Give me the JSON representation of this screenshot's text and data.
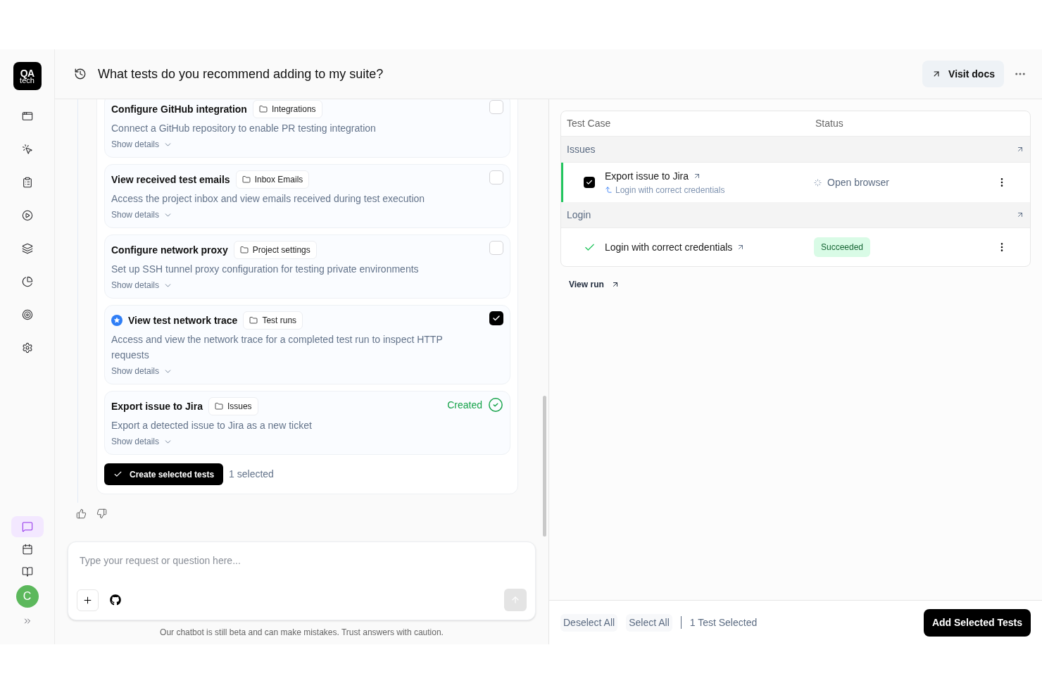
{
  "sidebar": {
    "logo": {
      "line1": "QA",
      "line2": "tech"
    },
    "nav_items": [
      {
        "kind": "window",
        "selected": false
      },
      {
        "kind": "click",
        "selected": false
      },
      {
        "kind": "clipboard",
        "selected": false
      },
      {
        "kind": "play",
        "selected": false
      },
      {
        "kind": "layers",
        "selected": false
      },
      {
        "kind": "pie",
        "selected": false
      },
      {
        "kind": "target",
        "selected": false
      },
      {
        "kind": "settings",
        "selected": false
      }
    ],
    "bottom_items": [
      {
        "kind": "chat",
        "selected": true
      },
      {
        "kind": "calendar",
        "selected": false
      },
      {
        "kind": "book",
        "selected": false
      }
    ],
    "avatar": "C"
  },
  "header": {
    "title": "What tests do you recommend adding to my suite?",
    "docs_button": "Visit docs"
  },
  "suggestions": [
    {
      "title": "Configure GitHub integration",
      "folder": "Integrations",
      "description": "Connect a GitHub repository to enable PR testing integration",
      "details": "Show details",
      "starred": false,
      "kind": "checkbox",
      "checked": false
    },
    {
      "title": "View received test emails",
      "folder": "Inbox Emails",
      "description": "Access the project inbox and view emails received during test execution",
      "details": "Show details",
      "starred": false,
      "kind": "checkbox",
      "checked": false
    },
    {
      "title": "Configure network proxy",
      "folder": "Project settings",
      "description": "Set up SSH tunnel proxy configuration for testing private environments",
      "details": "Show details",
      "starred": false,
      "kind": "checkbox",
      "checked": false
    },
    {
      "title": "View test network trace",
      "folder": "Test runs",
      "description": "Access and view the network trace for a completed test run to inspect HTTP requests",
      "details": "Show details",
      "starred": true,
      "kind": "checkbox",
      "checked": true
    },
    {
      "title": "Export issue to Jira",
      "folder": "Issues",
      "description": "Export a detected issue to Jira as a new ticket",
      "details": "Show details",
      "starred": false,
      "kind": "created",
      "status": "Created"
    }
  ],
  "create_button": "Create selected tests",
  "selected_count": "1 selected",
  "input": {
    "placeholder": "Type your request or question here..."
  },
  "disclaimer": "Our chatbot is still beta and can make mistakes. Trust answers with caution.",
  "table": {
    "columns": [
      "Test Case",
      "Status"
    ],
    "groups": [
      {
        "name": "Issues",
        "rows": [
          {
            "kind": "selectable",
            "checked": true,
            "active": true,
            "name": "Export issue to Jira",
            "parent": "Login with correct credentials",
            "status": {
              "kind": "running",
              "text": "Open browser"
            }
          }
        ]
      },
      {
        "name": "Login",
        "rows": [
          {
            "kind": "passed",
            "active": false,
            "name": "Login with correct credentials",
            "status": {
              "kind": "succeeded",
              "text": "Succeeded"
            }
          }
        ]
      }
    ]
  },
  "view_run": "View run",
  "footer": {
    "deselect": "Deselect All",
    "select": "Select All",
    "count": "1 Test Selected",
    "add": "Add Selected Tests"
  }
}
